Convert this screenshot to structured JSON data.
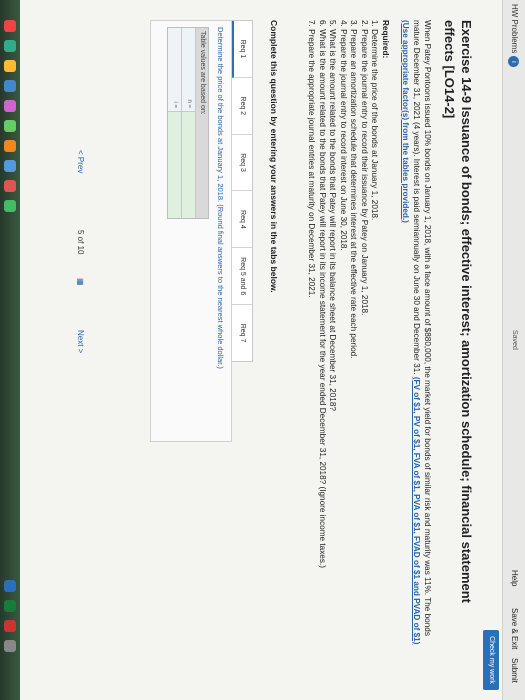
{
  "header": {
    "title": "HW Problems",
    "badge": "i",
    "saved": "Saved",
    "help": "Help",
    "save_exit": "Save & Exit",
    "submit": "Submit",
    "check": "Check my work"
  },
  "exercise": {
    "title": "Exercise 14-9 Issuance of bonds; effective interest; amortization schedule; financial statement effects [LO14-2]",
    "para1": "When Patey Pontoons issued 10% bonds on January 1, 2018, with a face amount of $880,000, the market yield for bonds of similar risk and maturity was 11%. The bonds mature December 31, 2021 (4 years). Interest is paid semiannually on June 30 and December 31.",
    "link": "(FV of $1, PV of $1, FVA of $1, PVA of $1, FVAD of $1 and PVAD of $1) (Use appropriate factor(s) from the tables provided.)"
  },
  "required": {
    "heading": "Required:",
    "items": [
      "1. Determine the price of the bonds at January 1, 2018.",
      "2. Prepare the journal entry to record their issuance by Patey on January 1, 2018.",
      "3. Prepare an amortization schedule that determines interest at the effective rate each period.",
      "4. Prepare the journal entry to record interest on June 30, 2018.",
      "5. What is the amount related to the bonds that Patey will report in its balance sheet at December 31, 2018?",
      "6. What is the amount related to the bonds that Patey will report in its income statement for the year ended December 31, 2018? (Ignore income taxes.)",
      "7. Prepare the appropriate journal entries at maturity on December 31, 2021."
    ]
  },
  "instruction": "Complete this question by entering your answers in the tabs below.",
  "tabs": [
    "Req 1",
    "Req 2",
    "Req 3",
    "Req 4",
    "Req 5 and 6",
    "Req 7"
  ],
  "panel": {
    "question": "Determine the price of the bonds at January 1, 2018.",
    "question_note": "(Round final answers to the nearest whole dollar.)",
    "table_header": "Table values are based on:",
    "row1_label": "n =",
    "row2_label": "i ="
  },
  "nav": {
    "prev": "< Prev",
    "count": "5 of 10",
    "next": "Next >"
  },
  "colors": {
    "accent": "#2a6fb8"
  }
}
